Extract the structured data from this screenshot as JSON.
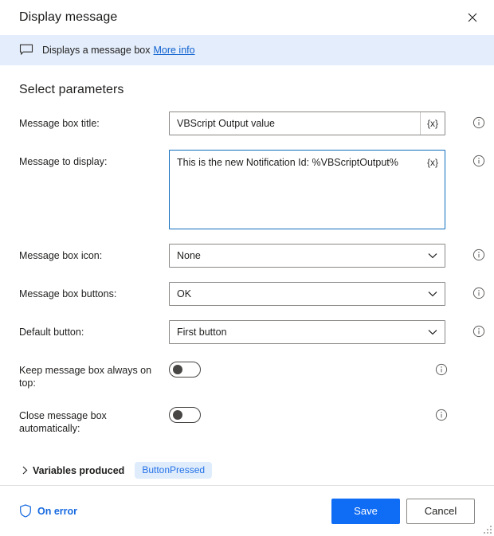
{
  "window": {
    "title": "Display message",
    "close_label": "✕"
  },
  "infobar": {
    "icon": "message-bubble-icon",
    "text": "Displays a message box",
    "link_label": "More info"
  },
  "main": {
    "section_title": "Select parameters",
    "variable_button_label": "{x}",
    "info_icon_label": "ⓘ"
  },
  "fields": [
    {
      "label": "Message box title:",
      "type": "text",
      "value": "VBScript Output value",
      "name": "message-box-title"
    },
    {
      "label": "Message to display:",
      "type": "textarea",
      "value": "This is the new Notification Id: %VBScriptOutput%",
      "name": "message-to-display"
    },
    {
      "label": "Message box icon:",
      "type": "dropdown",
      "value": "None",
      "name": "message-box-icon"
    },
    {
      "label": "Message box buttons:",
      "type": "dropdown",
      "value": "OK",
      "name": "message-box-buttons"
    },
    {
      "label": "Default button:",
      "type": "dropdown",
      "value": "First button",
      "name": "default-button"
    },
    {
      "label": "Keep message box always on top:",
      "type": "toggle",
      "value": "off",
      "name": "keep-always-on-top"
    },
    {
      "label": "Close message box automatically:",
      "type": "toggle",
      "value": "off",
      "name": "close-automatically"
    }
  ],
  "variables_produced": {
    "label": "Variables produced",
    "expander": "›",
    "badges": [
      "ButtonPressed"
    ]
  },
  "footer": {
    "on_error_label": "On error",
    "save_label": "Save",
    "cancel_label": "Cancel"
  },
  "colors": {
    "accent": "#0f6cf5",
    "link": "#0f62d0",
    "banner_bg": "#e4edfb",
    "badge_bg": "#deecfb",
    "badge_text": "#2572e8",
    "focus_border": "#0f6cbd"
  }
}
